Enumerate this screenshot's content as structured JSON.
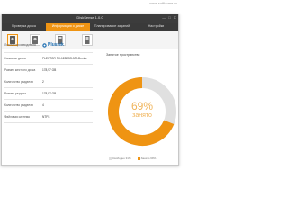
{
  "watermark": "www.softhome.ru",
  "window": {
    "title": "DiskSense 1.0.0",
    "controls": [
      "—",
      "□",
      "✕"
    ]
  },
  "tabs": [
    {
      "label": "Проверка диска",
      "active": false
    },
    {
      "label": "Информация о диске",
      "active": true
    },
    {
      "label": "Планирование заданий",
      "active": false
    },
    {
      "label": "Настройки",
      "active": false
    }
  ],
  "toolbar": {
    "items": [
      "drive-1",
      "drive-2",
      "drive-3",
      "drive-4"
    ],
    "selected_index": 0
  },
  "info": {
    "rows": [
      {
        "label": "Логотип производителя",
        "value": "Plustek"
      },
      {
        "label": "Название диска",
        "value": "PLEXTOR PX-128M5S ATA Device"
      },
      {
        "label": "Размер жесткого диска",
        "value": "178,97 GB"
      },
      {
        "label": "Количество разделов",
        "value": "2"
      },
      {
        "label": "Размер раздела",
        "value": "178,97 GB"
      },
      {
        "label": "Количество разделов",
        "value": "4"
      },
      {
        "label": "Файловая система",
        "value": "NTFS"
      }
    ]
  },
  "space": {
    "title": "Занятое пространство",
    "used_percent": 69,
    "percent_label": "69%",
    "used_label": "занято",
    "legend_free": "Свободно 31%",
    "legend_used": "Занято 69%",
    "colors": {
      "used": "#ef9413",
      "free": "#e0e0e0"
    }
  }
}
